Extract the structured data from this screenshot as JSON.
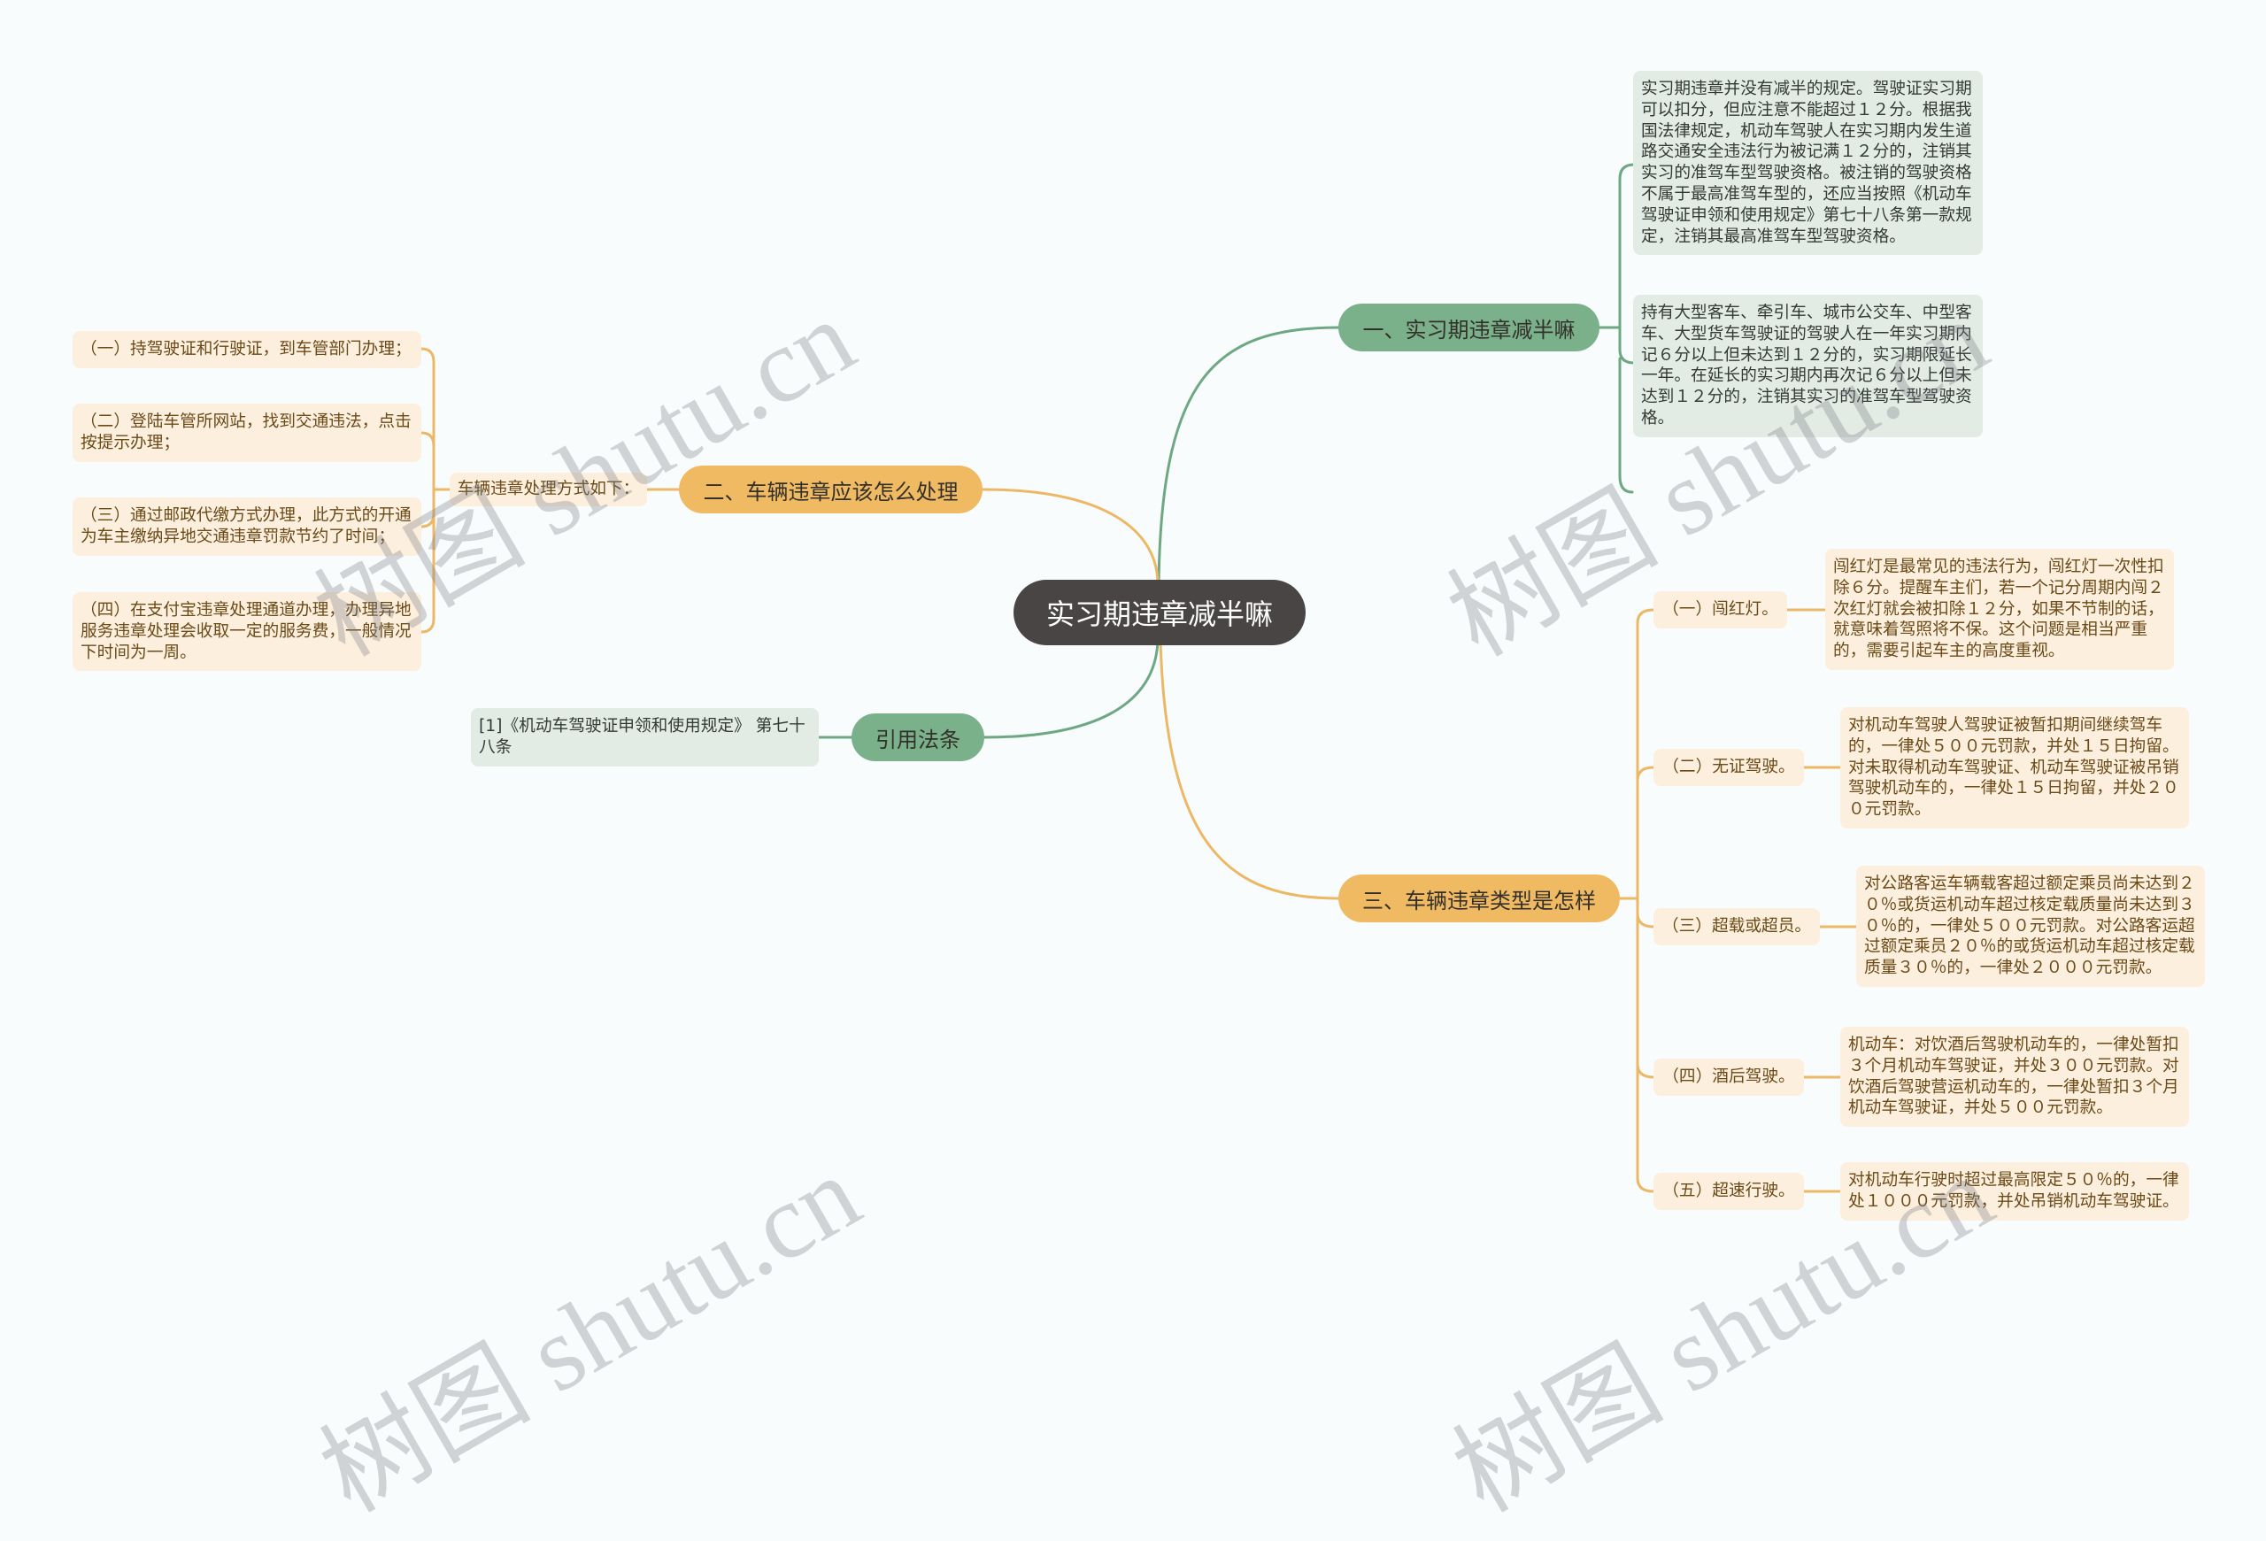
{
  "mindmap": {
    "root": {
      "label": "实习期违章减半嘛"
    },
    "branch_1": {
      "label": "一、实习期违章减半嘛",
      "details": [
        "实习期违章并没有减半的规定。驾驶证实习期可以扣分，但应注意不能超过１２分。根据我国法律规定，机动车驾驶人在实习期内发生道路交通安全违法行为被记满１２分的，注销其实习的准驾车型驾驶资格。被注销的驾驶资格不属于最高准驾车型的，还应当按照《机动车驾驶证申领和使用规定》第七十八条第一款规定，注销其最高准驾车型驾驶资格。",
        "持有大型客车、牵引车、城市公交车、中型客车、大型货车驾驶证的驾驶人在一年实习期内记６分以上但未达到１２分的，实习期限延长一年。在延长的实习期内再次记６分以上但未达到１２分的，注销其实习的准驾车型驾驶资格。"
      ]
    },
    "branch_2": {
      "label": "二、车辆违章应该怎么处理",
      "intro": "车辆违章处理方式如下：",
      "methods": [
        "（一）持驾驶证和行驶证，到车管部门办理；",
        "（二）登陆车管所网站，找到交通违法，点击按提示办理；",
        "（三）通过邮政代缴方式办理，此方式的开通为车主缴纳异地交通违章罚款节约了时间；",
        "（四）在支付宝违章处理通道办理，办理异地服务违章处理会收取一定的服务费，一般情况下时间为一周。"
      ]
    },
    "references": {
      "label": "引用法条",
      "items": [
        "[1]《机动车驾驶证申领和使用规定》 第七十八条"
      ]
    },
    "branch_3": {
      "label": "三、车辆违章类型是怎样",
      "types": [
        {
          "label": "（一）闯红灯。",
          "detail": "闯红灯是最常见的违法行为，闯红灯一次性扣除６分。提醒车主们，若一个记分周期内闯２次红灯就会被扣除１２分，如果不节制的话，就意味着驾照将不保。这个问题是相当严重的，需要引起车主的高度重视。"
        },
        {
          "label": "（二）无证驾驶。",
          "detail": "对机动车驾驶人驾驶证被暂扣期间继续驾车的，一律处５００元罚款，并处１５日拘留。对未取得机动车驾驶证、机动车驾驶证被吊销驾驶机动车的，一律处１５日拘留，并处２００元罚款。"
        },
        {
          "label": "（三）超载或超员。",
          "detail": "对公路客运车辆载客超过额定乘员尚未达到２０％或货运机动车超过核定载质量尚未达到３０％的，一律处５００元罚款。对公路客运超过额定乘员２０％的或货运机动车超过核定载质量３０％的，一律处２０００元罚款。"
        },
        {
          "label": "（四）酒后驾驶。",
          "detail": "机动车：对饮酒后驾驶机动车的，一律处暂扣３个月机动车驾驶证，并处３００元罚款。对饮酒后驾驶营运机动车的，一律处暂扣３个月机动车驾驶证，并处５００元罚款。"
        },
        {
          "label": "（五）超速行驶。",
          "detail": "对机动车行驶时超过最高限定５０％的，一律处１０００元罚款，并处吊销机动车驾驶证。"
        }
      ]
    }
  },
  "watermark": {
    "text": "树图 shutu.cn"
  },
  "theme": {
    "page_bg": "#f8fcfd",
    "root_bg": "#4a4545",
    "root_text": "#ffffff",
    "green_node": "#7ab18b",
    "green_box": "#e2ece5",
    "green_line": "#6ea882",
    "green_text": "#333a35",
    "orange_node": "#f0ba63",
    "orange_box": "#fdefde",
    "orange_line": "#ecb866",
    "orange_text": "#6a4a17",
    "node_text": "#33302b"
  }
}
